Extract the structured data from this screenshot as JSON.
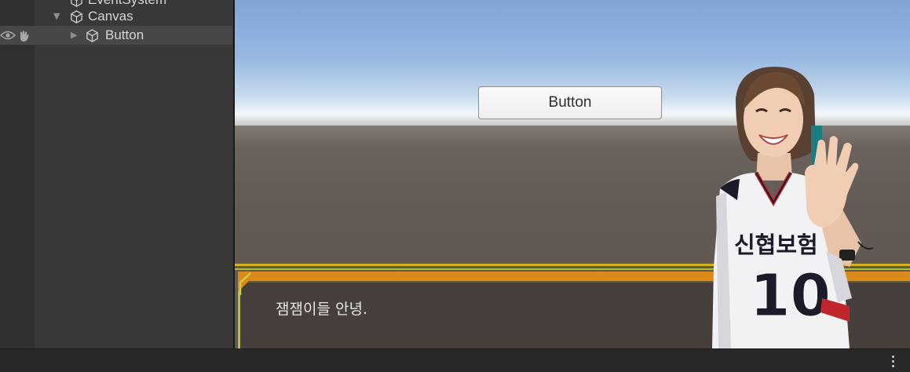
{
  "hierarchy": {
    "items": [
      {
        "label": "EventSystem",
        "expanded": null,
        "selected": false
      },
      {
        "label": "Canvas",
        "expanded": true,
        "selected": false
      },
      {
        "label": "Button",
        "expanded": false,
        "selected": true
      }
    ]
  },
  "game_view": {
    "button_label": "Button",
    "dialog_text": "잼잼이들 안녕.",
    "jersey_text": "신협보험",
    "jersey_number": "10"
  },
  "colors": {
    "panel_bg": "#383838",
    "selected_row": "#474747",
    "dialog_orange": "#d98a18",
    "dialog_yellow": "#d4b21a"
  },
  "icons": {
    "visibility": "eye-icon",
    "pickable": "hand-icon",
    "gameobject": "cube-icon",
    "more": "kebab-menu-icon"
  }
}
